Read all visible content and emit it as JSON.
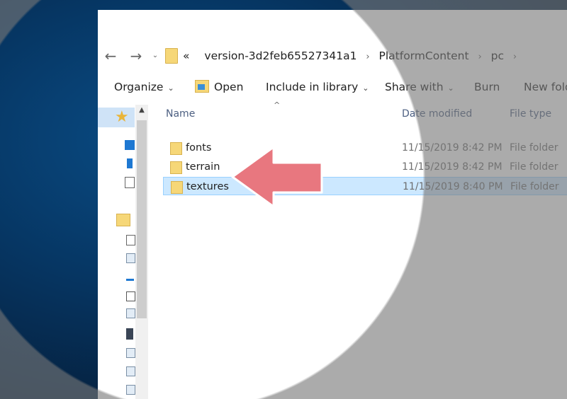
{
  "nav": {
    "back_glyph": "←",
    "forward_glyph": "→",
    "recent_glyph": "⌄"
  },
  "address": {
    "overflow": "«",
    "crumbs": [
      "version-3d2feb65527341a1",
      "PlatformContent",
      "pc"
    ],
    "sep_glyph": "›"
  },
  "toolbar": {
    "organize": "Organize",
    "open": "Open",
    "include": "Include in library",
    "share": "Share with",
    "burn": "Burn",
    "new_folder": "New fold",
    "chevron": "⌄"
  },
  "columns": {
    "name": "Name",
    "date": "Date modified",
    "type": "File type",
    "sort_glyph": "^"
  },
  "files": [
    {
      "name": "fonts",
      "date": "11/15/2019 8:42 PM",
      "type": "File folder",
      "selected": false
    },
    {
      "name": "terrain",
      "date": "11/15/2019 8:42 PM",
      "type": "File folder",
      "selected": false
    },
    {
      "name": "textures",
      "date": "11/15/2019 8:40 PM",
      "type": "File folder",
      "selected": true
    }
  ],
  "annotation": {
    "arrow_color": "#e8777f",
    "arrow_stroke": "#ffffff"
  },
  "icons": [
    "star-icon",
    "folder-icon",
    "back-arrow-icon",
    "forward-arrow-icon",
    "open-icon",
    "chevron-down-icon"
  ]
}
